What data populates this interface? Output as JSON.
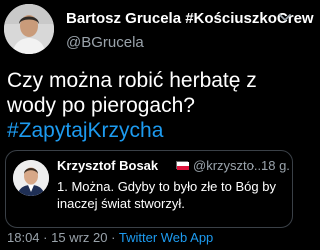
{
  "tweet": {
    "author": {
      "display_name": "Bartosz Grucela #KościuszkoCrew",
      "handle": "@BGrucela"
    },
    "more_icon": "chevron-down-icon",
    "text": "Czy można robić herbatę z wody po pierogach?",
    "hashtag": "#ZapytajKrzycha",
    "quoted": {
      "display_name": "Krzysztof Bosak",
      "flag_colors": [
        "#ffffff",
        "#dc143c"
      ],
      "handle": "@krzyszto...",
      "separator": "·",
      "time": "18 g.",
      "text": "1. Można. Gdyby to było złe to Bóg by inaczej świat stworzył."
    },
    "meta": {
      "time": "18:04",
      "separator1": "·",
      "date": "15 wrz 20",
      "separator2": "·",
      "source": "Twitter Web App"
    },
    "colors": {
      "background": "#000000",
      "link": "#1d9bf0",
      "secondary_text": "#9aa3ab",
      "border": "#3a4047"
    }
  }
}
